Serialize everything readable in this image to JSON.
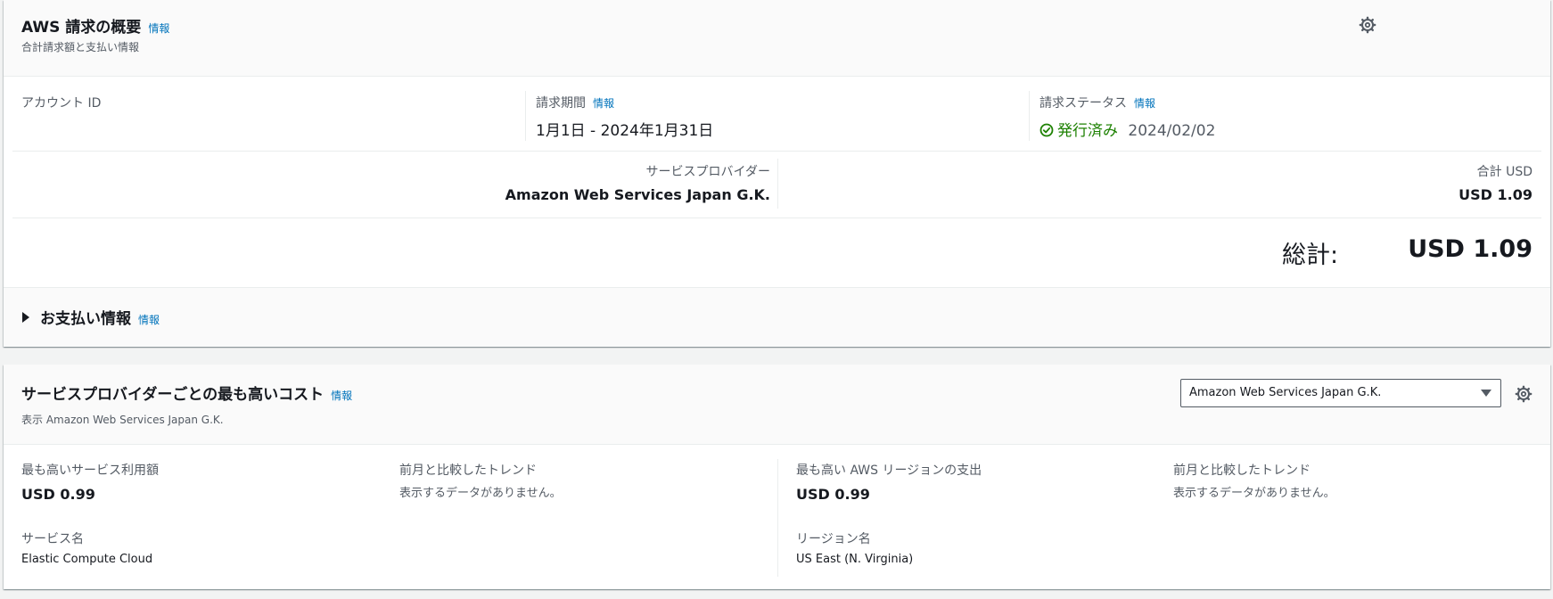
{
  "summary": {
    "title": "AWS 請求の概要",
    "info": "情報",
    "subtitle": "合計請求額と支払い情報",
    "account_label": "アカウント ID",
    "period_label": "請求期間",
    "period_info": "情報",
    "period_value": "1月1日 - 2024年1月31日",
    "status_label": "請求ステータス",
    "status_info": "情報",
    "status_value": "発行済み",
    "status_date": "2024/02/02",
    "status_color": "#1d8102",
    "provider_label": "サービスプロバイダー",
    "provider_value": "Amazon Web Services Japan G.K.",
    "total_usd_label": "合計 USD",
    "total_usd_value": "USD 1.09",
    "grand_total_label": "総計:",
    "grand_total_value": "USD 1.09",
    "payment_label": "お支払い情報",
    "payment_info": "情報"
  },
  "top_costs": {
    "title": "サービスプロバイダーごとの最も高いコスト",
    "info": "情報",
    "subtitle": "表示 Amazon Web Services Japan G.K.",
    "select_value": "Amazon Web Services Japan G.K.",
    "service_spend_label": "最も高いサービス利用額",
    "service_spend_value": "USD 0.99",
    "trend_label_1": "前月と比較したトレンド",
    "trend_value_1": "表示するデータがありません。",
    "service_name_label": "サービス名",
    "service_name_value": "Elastic Compute Cloud",
    "region_spend_label": "最も高い AWS リージョンの支出",
    "region_spend_value": "USD 0.99",
    "trend_label_2": "前月と比較したトレンド",
    "trend_value_2": "表示するデータがありません。",
    "region_name_label": "リージョン名",
    "region_name_value": "US East (N. Virginia)"
  },
  "colors": {
    "link": "#0073bb",
    "text": "#16191f",
    "muted": "#545b64",
    "success": "#1d8102"
  },
  "icons": {
    "settings": "gear-icon",
    "status": "check-circle-icon",
    "expand": "caret-right-icon",
    "dropdown": "caret-down-icon"
  }
}
